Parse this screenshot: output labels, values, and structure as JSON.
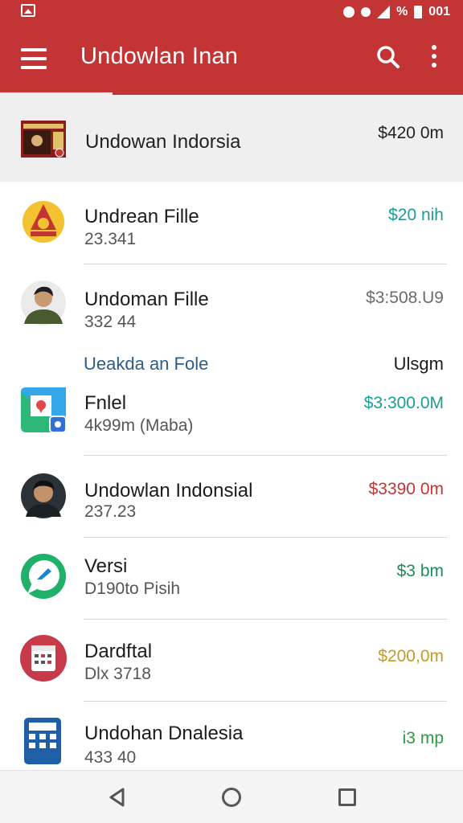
{
  "status_bar": {
    "time": "001",
    "battery_glyph": "%"
  },
  "app_bar": {
    "title": "Undowlan Inan"
  },
  "featured": {
    "name": "Undowan Indorsia",
    "price": "$420 0m"
  },
  "rows": [
    {
      "name": "Undrean Fille",
      "sub": "23.341",
      "price": "$20 nih",
      "price_color": "#1a9e94"
    },
    {
      "name": "Undoman Fille",
      "sub": "332 44",
      "price": "$3:508.U9",
      "price_color": "#6b6b6b"
    }
  ],
  "section": {
    "label": "Ueakda an Fole",
    "right": "Ulsgm"
  },
  "rows2": [
    {
      "name": "Fnlel",
      "sub": "4k99m (Maba)",
      "price": "$3:300.0M",
      "price_color": "#1a9e94"
    },
    {
      "name": "Undowlan Indonsial",
      "sub": "237.23",
      "price": "$3390 0m",
      "price_color": "#c33434"
    },
    {
      "name": "Versi",
      "sub": "D190to Pisih",
      "price": "$3 bm",
      "price_color": "#1d8a5e"
    },
    {
      "name": "Dardftal",
      "sub": "Dlx 3718",
      "price": "$200,0m",
      "price_color": "#c49a2a"
    },
    {
      "name": "Undohan Dnalesia",
      "sub": "433 40",
      "price": "i3 mp",
      "price_color": "#2e9a46"
    }
  ],
  "colors": {
    "primary": "#c33434",
    "accent_teal": "#1a9e94"
  }
}
